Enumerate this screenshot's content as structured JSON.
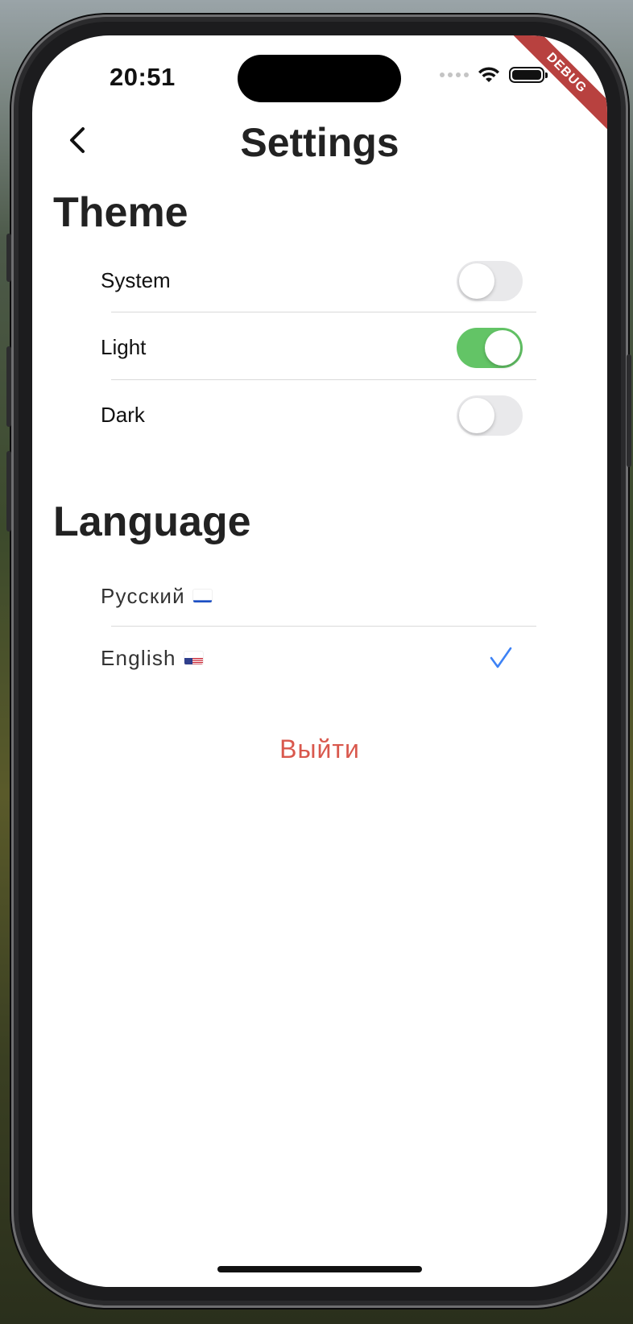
{
  "status_bar": {
    "time": "20:51"
  },
  "debug_banner": "DEBUG",
  "header": {
    "title": "Settings",
    "back_icon": "chevron-left-icon"
  },
  "theme": {
    "title": "Theme",
    "options": [
      {
        "label": "System",
        "enabled": false
      },
      {
        "label": "Light",
        "enabled": true
      },
      {
        "label": "Dark",
        "enabled": false
      }
    ]
  },
  "language": {
    "title": "Language",
    "options": [
      {
        "label": "Русский",
        "flag": "ru-flag-icon",
        "selected": false
      },
      {
        "label": "English",
        "flag": "us-flag-icon",
        "selected": true
      }
    ],
    "selected_icon": "checkmark-icon"
  },
  "logout_label": "Выйти",
  "colors": {
    "toggle_on": "#63c466",
    "toggle_off": "#e9e9eb",
    "checkmark": "#3d82f5",
    "logout": "#d9584d",
    "debug_ribbon": "#b8413f"
  }
}
